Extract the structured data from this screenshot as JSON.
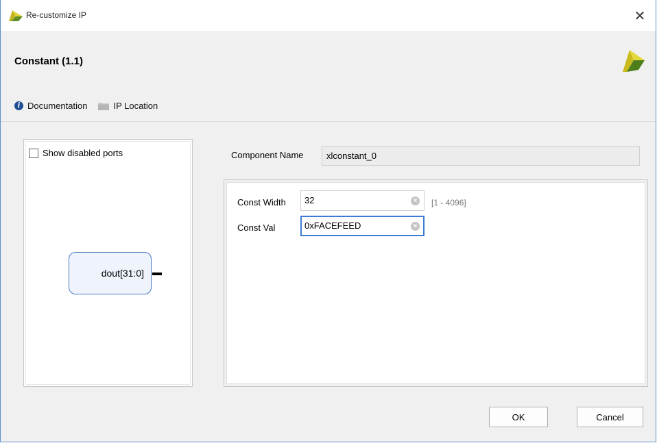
{
  "window": {
    "title": "Re-customize IP",
    "close_glyph": "✕"
  },
  "header": {
    "ip_title": "Constant (1.1)",
    "links": [
      {
        "label": "Documentation",
        "icon": "info-icon"
      },
      {
        "label": "IP Location",
        "icon": "folder-icon"
      }
    ]
  },
  "symbol_panel": {
    "show_disabled_ports_label": "Show disabled ports",
    "show_disabled_ports_checked": false,
    "port_label": "dout[31:0]"
  },
  "component": {
    "label": "Component Name",
    "value": "xlconstant_0"
  },
  "params": {
    "const_width": {
      "label": "Const Width",
      "value": "32",
      "range": "[1 - 4096]"
    },
    "const_val": {
      "label": "Const Val",
      "value": "0xFACEFEED"
    }
  },
  "buttons": {
    "ok": "OK",
    "cancel": "Cancel"
  },
  "colors": {
    "accent": "#3d7ad6",
    "port_border": "#4a78c0",
    "brand_yellow": "#d7c929",
    "brand_green": "#4d7a1e"
  }
}
